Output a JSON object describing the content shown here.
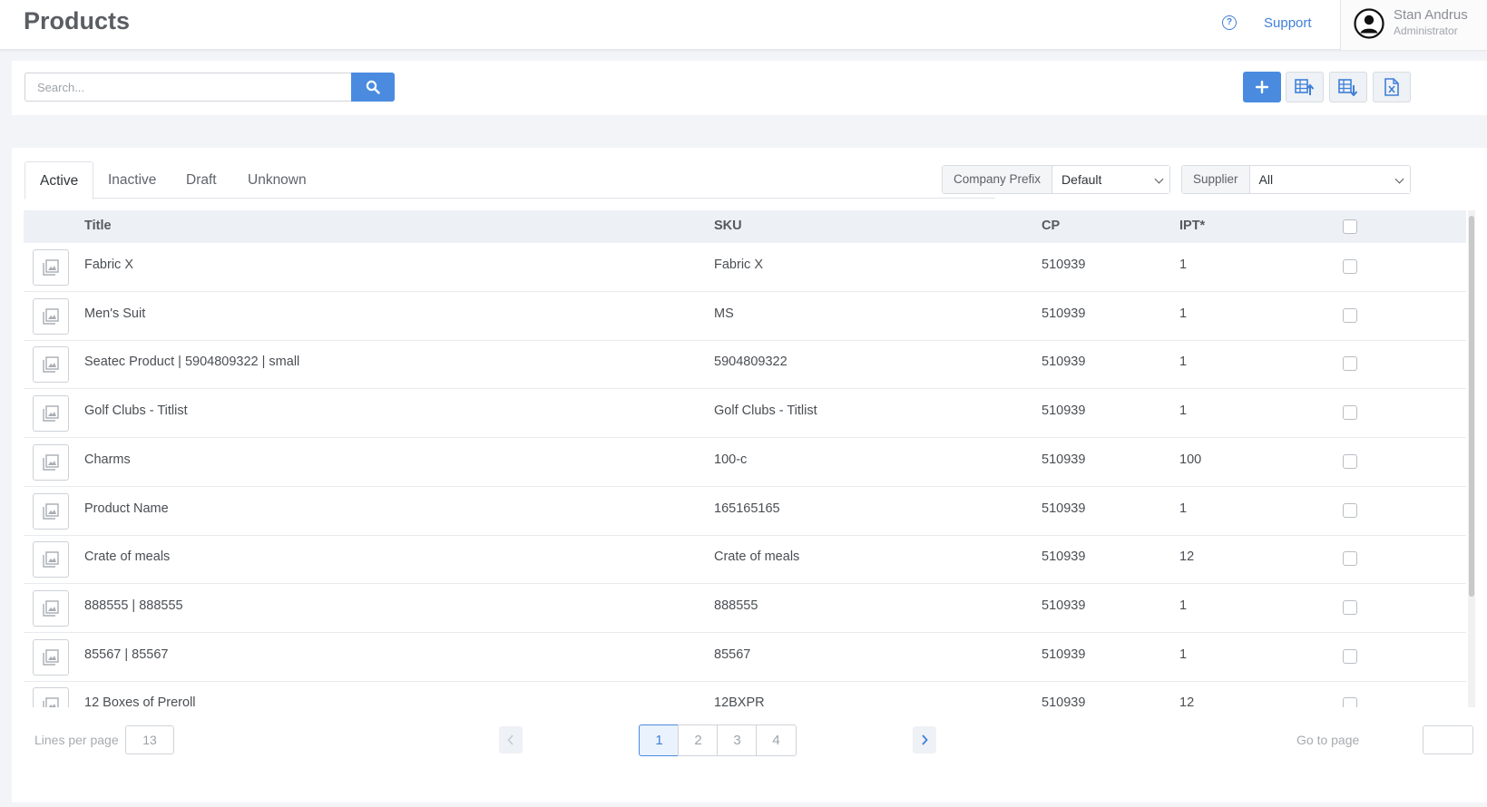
{
  "header": {
    "title": "Products",
    "support_label": "Support",
    "help_glyph": "?",
    "user": {
      "name": "Stan Andrus",
      "role": "Administrator"
    }
  },
  "toolbar": {
    "search_placeholder": "Search...",
    "buttons": [
      "add-icon",
      "excel-import-icon",
      "excel-export-icon",
      "excel-file-icon"
    ]
  },
  "tabs": [
    "Active",
    "Inactive",
    "Draft",
    "Unknown"
  ],
  "filters": {
    "company_prefix": {
      "label": "Company Prefix",
      "value": "Default"
    },
    "supplier": {
      "label": "Supplier",
      "value": "All"
    }
  },
  "table": {
    "columns": {
      "title": "Title",
      "sku": "SKU",
      "cp": "CP",
      "ipt": "IPT*"
    },
    "rows": [
      {
        "title": "Fabric X",
        "sku": "Fabric X",
        "cp": "510939",
        "ipt": "1"
      },
      {
        "title": "Men's Suit",
        "sku": "MS",
        "cp": "510939",
        "ipt": "1"
      },
      {
        "title": "Seatec Product | 5904809322 | small",
        "sku": "5904809322",
        "cp": "510939",
        "ipt": "1"
      },
      {
        "title": "Golf Clubs - Titlist",
        "sku": "Golf Clubs - Titlist",
        "cp": "510939",
        "ipt": "1"
      },
      {
        "title": "Charms",
        "sku": "100-c",
        "cp": "510939",
        "ipt": "100"
      },
      {
        "title": "Product Name",
        "sku": "165165165",
        "cp": "510939",
        "ipt": "1"
      },
      {
        "title": "Crate of meals",
        "sku": "Crate of meals",
        "cp": "510939",
        "ipt": "12"
      },
      {
        "title": "888555 | 888555",
        "sku": "888555",
        "cp": "510939",
        "ipt": "1"
      },
      {
        "title": "85567 | 85567",
        "sku": "85567",
        "cp": "510939",
        "ipt": "1"
      },
      {
        "title": "12 Boxes of Preroll",
        "sku": "12BXPR",
        "cp": "510939",
        "ipt": "12"
      }
    ]
  },
  "pagination": {
    "lines_label": "Lines per page",
    "lines_value": "13",
    "pages": [
      "1",
      "2",
      "3",
      "4"
    ],
    "current_page": "1",
    "goto_label": "Go to page"
  },
  "colors": {
    "accent": "#4a8be0",
    "link": "#3f80d8",
    "header_bg": "#edf0f5"
  }
}
